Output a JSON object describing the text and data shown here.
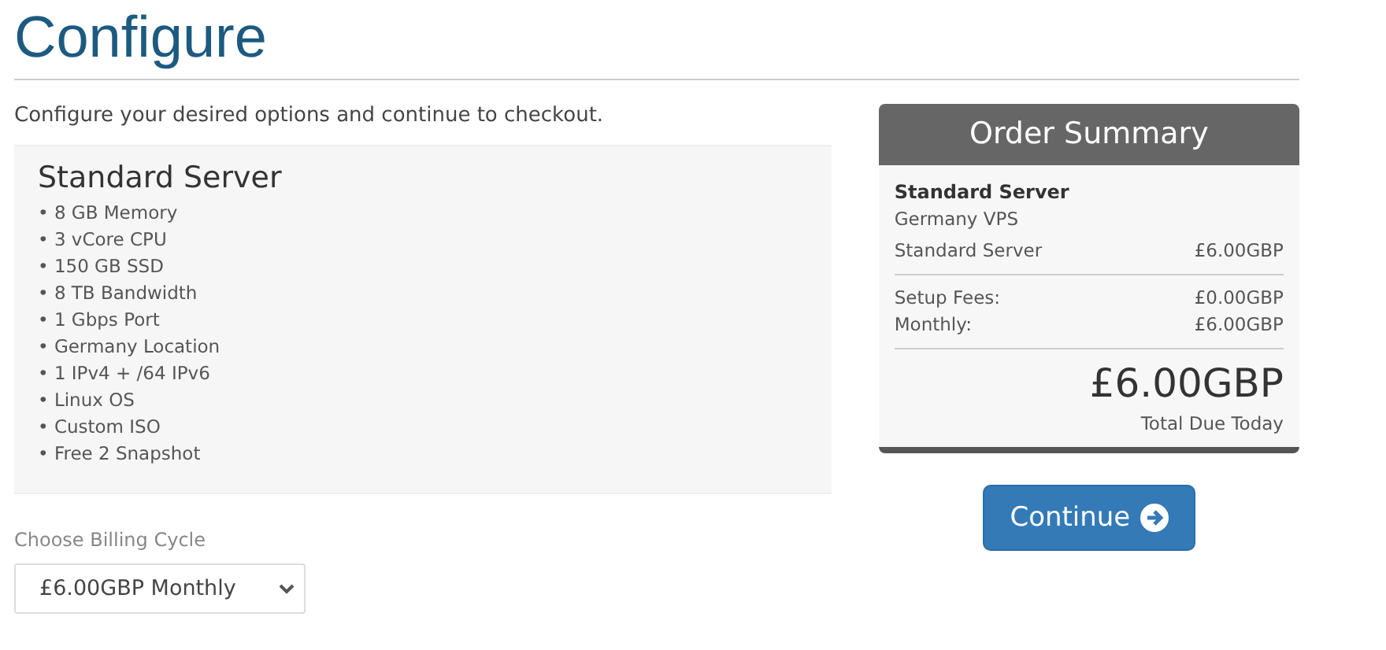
{
  "title": "Configure",
  "intro": "Configure your desired options and continue to checkout.",
  "product": {
    "name": "Standard Server",
    "features": [
      "• 8 GB Memory",
      "• 3 vCore CPU",
      "• 150 GB SSD",
      "• 8 TB Bandwidth",
      "• 1 Gbps Port",
      "• Germany Location",
      "• 1 IPv4 + /64 IPv6",
      "• Linux OS",
      "• Custom ISO",
      "• Free 2 Snapshot"
    ]
  },
  "billing": {
    "label": "Choose Billing Cycle",
    "value": "£6.00GBP Monthly"
  },
  "summary": {
    "title": "Order Summary",
    "product": "Standard Server",
    "group": "Germany VPS",
    "line": {
      "label": "Standard Server",
      "amount": "£6.00GBP"
    },
    "fees": [
      {
        "label": "Setup Fees:",
        "amount": "£0.00GBP"
      },
      {
        "label": "Monthly:",
        "amount": "£6.00GBP"
      }
    ],
    "total": "£6.00GBP",
    "total_label": "Total Due Today"
  },
  "continue_button": "Continue"
}
